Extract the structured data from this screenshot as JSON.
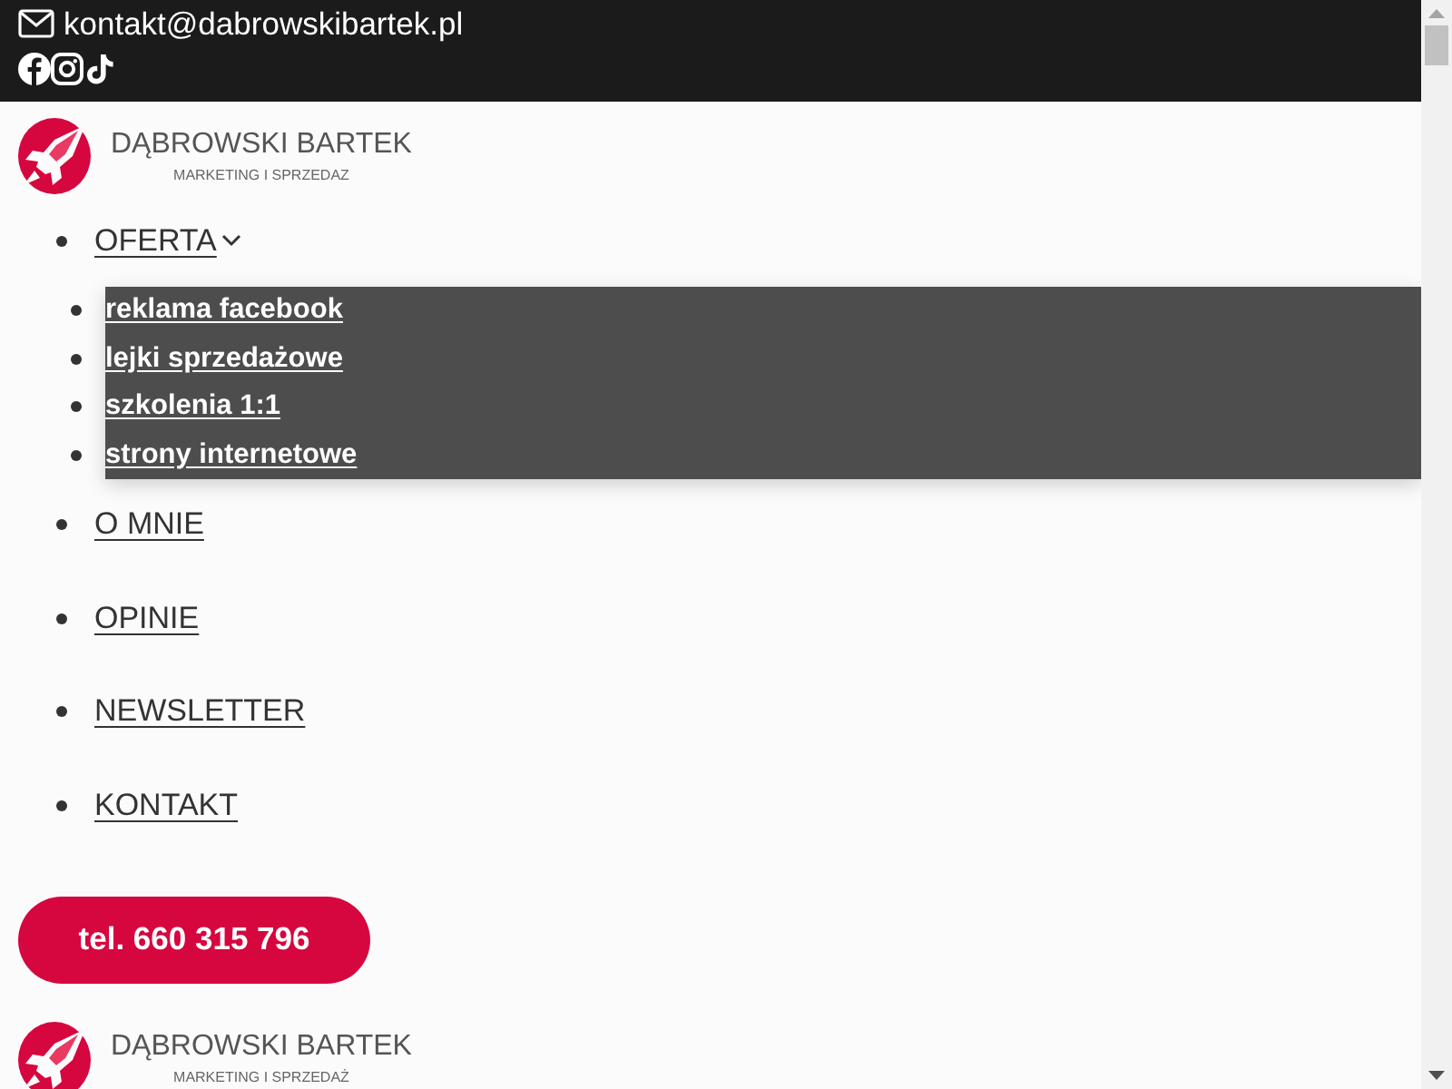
{
  "top_bar": {
    "email": "kontakt@dabrowskibartek.pl"
  },
  "header_logo": {
    "title": "DĄBROWSKI BARTEK",
    "subtitle": "MARKETING I SPRZEDAZ"
  },
  "nav": {
    "items": [
      {
        "label": "OFERTA",
        "expanded": true,
        "children": [
          {
            "label": "reklama facebook"
          },
          {
            "label": "lejki sprzedażowe"
          },
          {
            "label": "szkolenia 1:1"
          },
          {
            "label": "strony internetowe"
          }
        ]
      },
      {
        "label": "O MNIE"
      },
      {
        "label": "OPINIE"
      },
      {
        "label": "NEWSLETTER"
      },
      {
        "label": "KONTAKT"
      }
    ]
  },
  "call_button": {
    "label": "tel. 660 315 796"
  },
  "footer_logo": {
    "title": "DĄBROWSKI BARTEK",
    "subtitle": "MARKETING I SPRZEDAŻ"
  }
}
